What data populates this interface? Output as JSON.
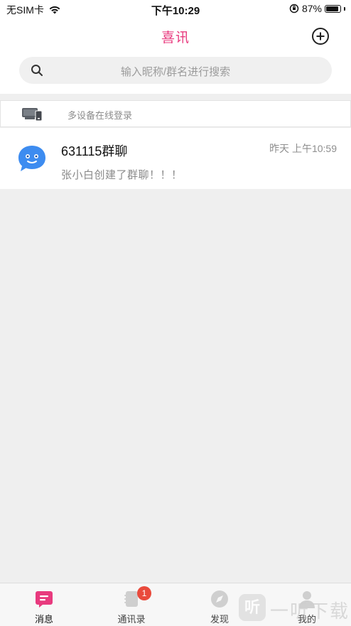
{
  "status_bar": {
    "carrier": "无SIM卡",
    "time": "下午10:29",
    "battery_percent": "87%",
    "battery_level": 0.87,
    "icons": [
      "wifi-icon",
      "rotation-lock-icon",
      "battery-icon"
    ]
  },
  "header": {
    "title": "喜讯",
    "add_icon": "plus-circle-icon"
  },
  "search": {
    "placeholder": "输入昵称/群名进行搜索",
    "icon": "search-icon"
  },
  "device_notice": {
    "text": "多设备在线登录",
    "icon": "devices-icon"
  },
  "conversations": [
    {
      "name": "631115群聊",
      "time": "昨天 上午10:59",
      "preview": "张小白创建了群聊！！！",
      "avatar_icon": "group-chat-avatar-icon"
    }
  ],
  "tab_bar": {
    "tabs": [
      {
        "label": "消息",
        "icon": "message-icon",
        "active": true
      },
      {
        "label": "通讯录",
        "icon": "contacts-icon",
        "badge": "1"
      },
      {
        "label": "发现",
        "icon": "discover-icon"
      },
      {
        "label": "我的",
        "icon": "profile-icon"
      }
    ]
  },
  "watermark": {
    "logo_text": "听",
    "text": "一听下载"
  },
  "colors": {
    "accent": "#e83a7e",
    "background": "#efefef",
    "avatar_blue": "#3d8cf0",
    "badge_red": "#e94a3c"
  }
}
